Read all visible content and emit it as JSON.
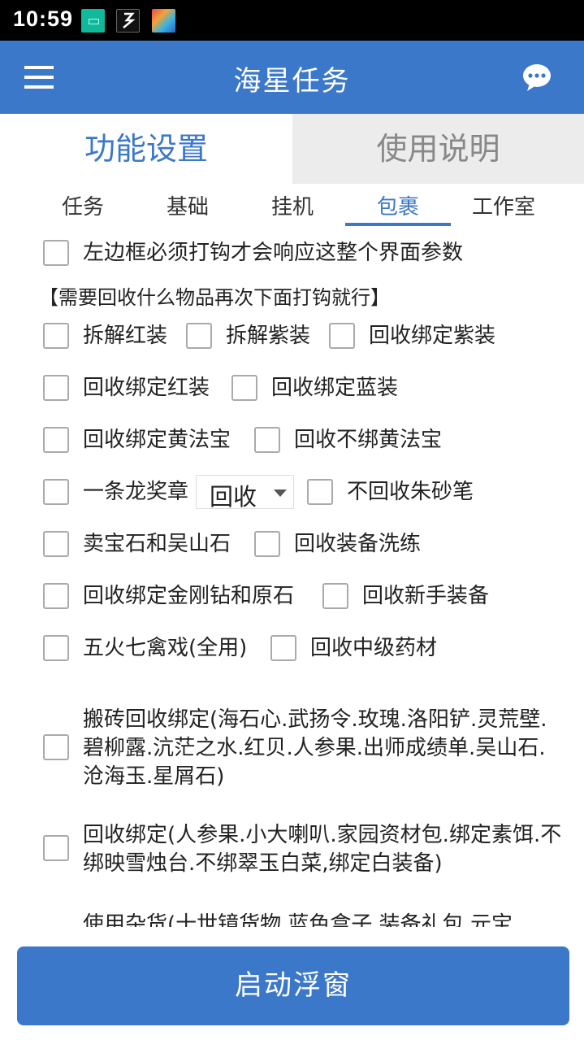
{
  "status_bar": {
    "time": "10:59",
    "icons": [
      "notification-app-icon",
      "notification-app-icon-2",
      "notification-app-icon-3"
    ]
  },
  "app_bar": {
    "title": "海星任务",
    "menu_icon": "hamburger-menu-icon",
    "chat_icon": "chat-bubble-icon",
    "color": "#3c78c9"
  },
  "top_tabs": [
    {
      "label": "功能设置",
      "active": true
    },
    {
      "label": "使用说明",
      "active": false
    }
  ],
  "sub_tabs": [
    {
      "label": "任务",
      "active": false
    },
    {
      "label": "基础",
      "active": false
    },
    {
      "label": "挂机",
      "active": false
    },
    {
      "label": "包裹",
      "active": true
    },
    {
      "label": "工作室",
      "active": false
    }
  ],
  "package": {
    "master_toggle": {
      "label": "左边框必须打钩才会响应这整个界面参数",
      "checked": false
    },
    "hint": "【需要回收什么物品再次下面打钩就行】",
    "rows": [
      [
        {
          "label": "拆解红装",
          "checked": false
        },
        {
          "label": "拆解紫装",
          "checked": false
        },
        {
          "label": "回收绑定紫装",
          "checked": false
        }
      ],
      [
        {
          "label": "回收绑定红装",
          "checked": false
        },
        {
          "label": "回收绑定蓝装",
          "checked": false
        }
      ],
      [
        {
          "label": "回收绑定黄法宝",
          "checked": false
        },
        {
          "label": "回收不绑黄法宝",
          "checked": false
        }
      ],
      [
        {
          "label": "一条龙奖章",
          "checked": false
        },
        {
          "label": "不回收朱砂笔",
          "checked": false
        }
      ],
      [
        {
          "label": "卖宝石和吴山石",
          "checked": false
        },
        {
          "label": "回收装备洗练",
          "checked": false
        }
      ],
      [
        {
          "label": "回收绑定金刚钻和原石",
          "checked": false
        },
        {
          "label": "回收新手装备",
          "checked": false
        }
      ],
      [
        {
          "label": "五火七禽戏(全用)",
          "checked": false
        },
        {
          "label": "回收中级药材",
          "checked": false
        }
      ]
    ],
    "medal_select": {
      "value": "回收"
    },
    "long_items": [
      {
        "label": "搬砖回收绑定(海石心.武扬令.玫瑰.洛阳铲.灵荒壁.碧柳露.沆茫之水.红贝.人参果.出师成绩单.吴山石.沧海玉.星屑石)",
        "checked": false
      },
      {
        "label": "回收绑定(人参果.小大喇叭.家园资材包.绑定素饵.不绑映雪烛台.不绑翠玉白菜,绑定白装备)",
        "checked": false
      },
      {
        "label": "使用杂货(十世镜货物.蓝色盒子.装备礼包.元宝",
        "checked": false
      }
    ]
  },
  "launch_button": {
    "label": "启动浮窗"
  }
}
